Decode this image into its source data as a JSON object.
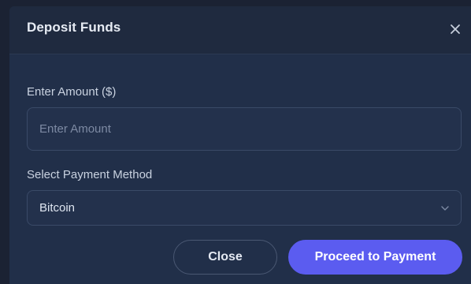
{
  "modal": {
    "title": "Deposit Funds",
    "close_icon": "close-icon"
  },
  "amount": {
    "label": "Enter Amount ($)",
    "placeholder": "Enter Amount",
    "value": ""
  },
  "payment_method": {
    "label": "Select Payment Method",
    "selected": "Bitcoin",
    "icon": "chevron-down-icon"
  },
  "actions": {
    "close_label": "Close",
    "proceed_label": "Proceed to Payment"
  },
  "colors": {
    "accent": "#5b5cf0",
    "modal_bg": "#212f49",
    "header_bg": "#1f2a3f"
  }
}
